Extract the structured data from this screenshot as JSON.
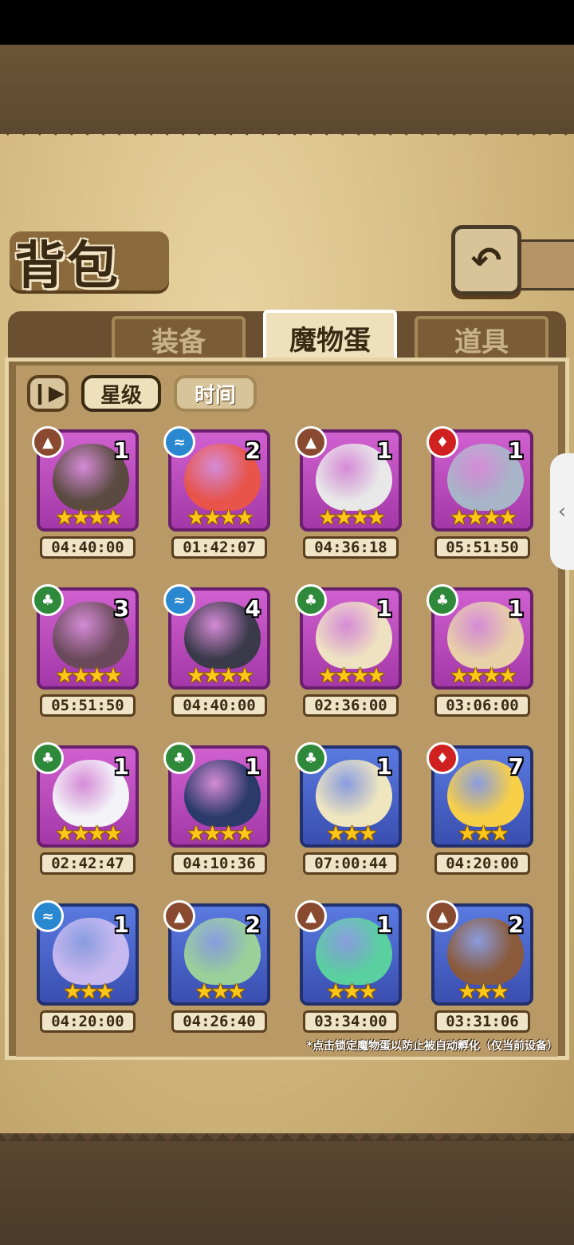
{
  "title": "背包",
  "back_icon": "back-arrow-icon",
  "tabs": [
    {
      "label": "装备",
      "active": false
    },
    {
      "label": "魔物蛋",
      "active": true
    },
    {
      "label": "道具",
      "active": false
    }
  ],
  "sort": {
    "icon": "pause-sort-icon",
    "star_label": "星级",
    "time_label": "时间"
  },
  "eggs": [
    {
      "element": "earth",
      "count": "1",
      "stars": 4,
      "timer": "04:40:00",
      "frame": "purple",
      "art_color": "#5a4a40"
    },
    {
      "element": "water",
      "count": "2",
      "stars": 4,
      "timer": "01:42:07",
      "frame": "purple",
      "art_color": "#e8544a"
    },
    {
      "element": "earth",
      "count": "1",
      "stars": 4,
      "timer": "04:36:18",
      "frame": "purple",
      "art_color": "#e8e8e8"
    },
    {
      "element": "fire",
      "count": "1",
      "stars": 4,
      "timer": "05:51:50",
      "frame": "purple",
      "art_color": "#a8b4c8"
    },
    {
      "element": "leaf",
      "count": "3",
      "stars": 4,
      "timer": "05:51:50",
      "frame": "purple",
      "art_color": "#6a4a5a"
    },
    {
      "element": "water",
      "count": "4",
      "stars": 4,
      "timer": "04:40:00",
      "frame": "purple",
      "art_color": "#3a3a4a"
    },
    {
      "element": "leaf",
      "count": "1",
      "stars": 4,
      "timer": "02:36:00",
      "frame": "purple",
      "art_color": "#efe2c2"
    },
    {
      "element": "leaf",
      "count": "1",
      "stars": 4,
      "timer": "03:06:00",
      "frame": "purple",
      "art_color": "#e8d0a8"
    },
    {
      "element": "leaf",
      "count": "1",
      "stars": 4,
      "timer": "02:42:47",
      "frame": "purple",
      "art_color": "#f4f4f8"
    },
    {
      "element": "leaf",
      "count": "1",
      "stars": 4,
      "timer": "04:10:36",
      "frame": "purple",
      "art_color": "#2a3a6a"
    },
    {
      "element": "leaf",
      "count": "1",
      "stars": 3,
      "timer": "07:00:44",
      "frame": "blue",
      "art_color": "#efe6c0"
    },
    {
      "element": "fire",
      "count": "7",
      "stars": 3,
      "timer": "04:20:00",
      "frame": "blue",
      "art_color": "#f8d048"
    },
    {
      "element": "water",
      "count": "1",
      "stars": 3,
      "timer": "04:20:00",
      "frame": "blue",
      "art_color": "#c8b8f0"
    },
    {
      "element": "earth",
      "count": "2",
      "stars": 3,
      "timer": "04:26:40",
      "frame": "blue",
      "art_color": "#9ad09a"
    },
    {
      "element": "earth",
      "count": "1",
      "stars": 3,
      "timer": "03:34:00",
      "frame": "blue",
      "art_color": "#5ad0a0"
    },
    {
      "element": "earth",
      "count": "2",
      "stars": 3,
      "timer": "03:31:06",
      "frame": "blue",
      "art_color": "#8a5a3a"
    }
  ],
  "element_icons": {
    "earth": "earth-element-icon",
    "water": "water-element-icon",
    "fire": "fire-element-icon",
    "leaf": "leaf-element-icon"
  },
  "footnote": "*点击锁定魔物蛋以防止被自动孵化（仅当前设备）",
  "side_handle_icon": "chevron-left-icon"
}
